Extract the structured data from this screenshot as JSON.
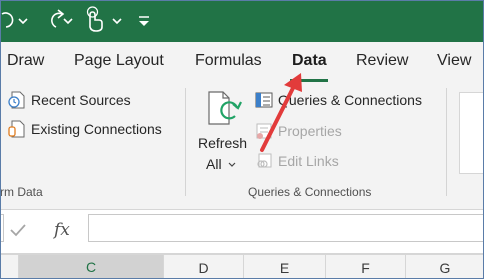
{
  "colors": {
    "accent": "#217346",
    "arrow": "#e23b3b"
  },
  "qat": {
    "items": [
      "redo-icon",
      "touch-mode-icon",
      "customize-qat-icon"
    ]
  },
  "tabs": [
    {
      "label": "Draw"
    },
    {
      "label": "Page Layout"
    },
    {
      "label": "Formulas"
    },
    {
      "label": "Data",
      "active": true
    },
    {
      "label": "Review"
    },
    {
      "label": "View"
    }
  ],
  "ribbon": {
    "get_transform": {
      "recent_sources": "Recent Sources",
      "existing_connections": "Existing Connections",
      "group_label": "rm Data"
    },
    "queries": {
      "refresh_label": "Refresh",
      "refresh_sub": "All",
      "queries_connections": "Queries & Connections",
      "properties": "Properties",
      "edit_links": "Edit Links",
      "group_label": "Queries & Connections"
    }
  },
  "formula_bar": {
    "fx": "fx",
    "value": ""
  },
  "columns": [
    "C",
    "D",
    "E",
    "F",
    "G"
  ],
  "selected_column": "C"
}
